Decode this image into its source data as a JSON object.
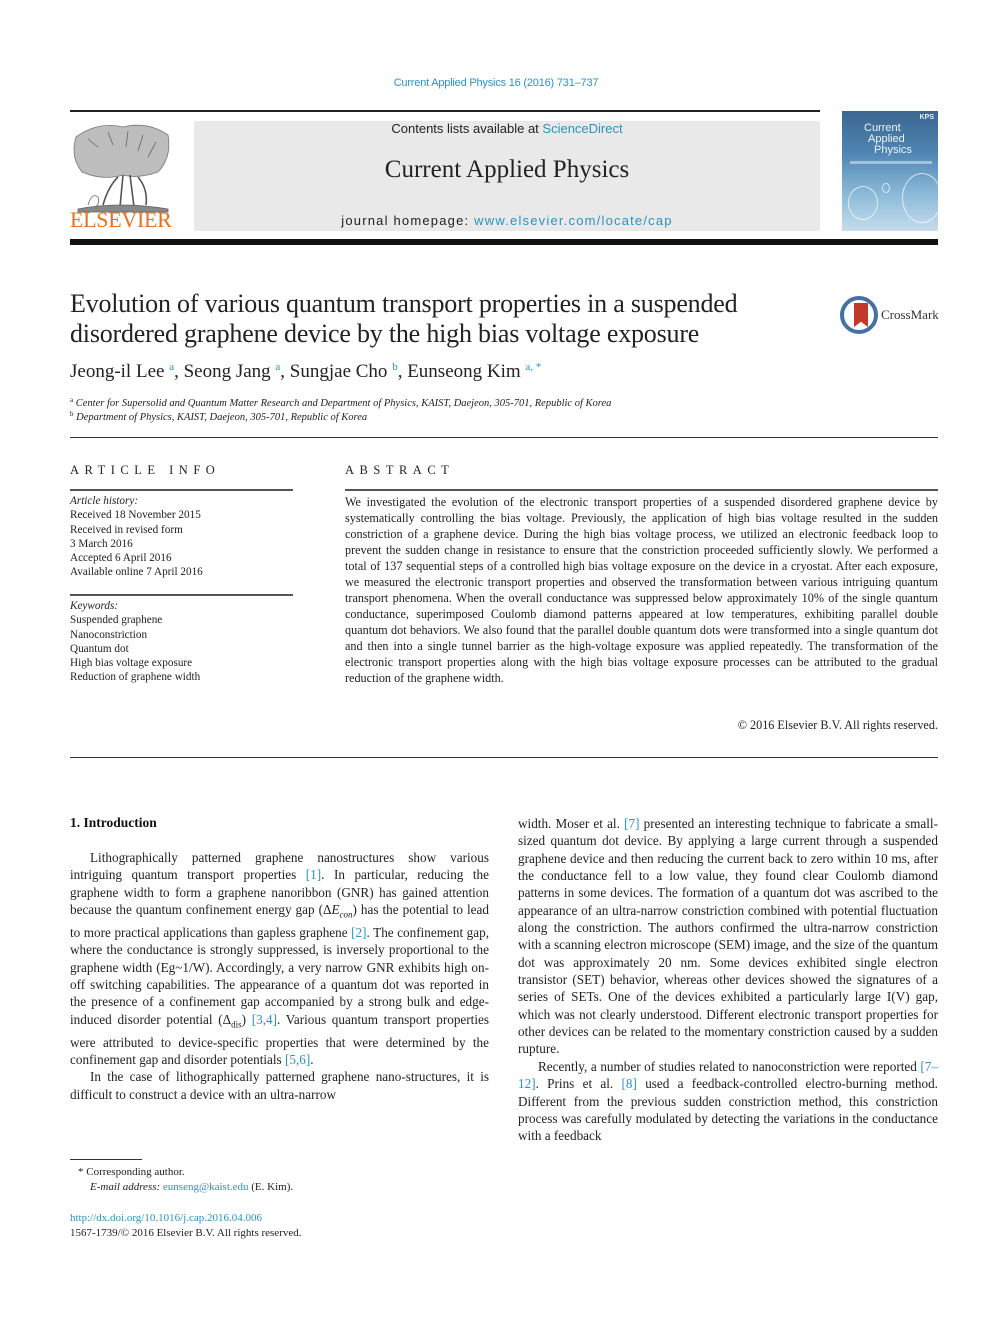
{
  "running_head": "Current Applied Physics 16 (2016) 731–737",
  "masthead": {
    "contents_prefix": "Contents lists available at ",
    "contents_link": "ScienceDirect",
    "journal_title": "Current Applied Physics",
    "homepage_prefix": "journal homepage: ",
    "homepage_link": "www.elsevier.com/locate/cap",
    "publisher_logo_text": "ELSEVIER",
    "cover": {
      "title_line1": "Current",
      "title_line2": "Applied",
      "title_line3": "Physics",
      "badge": "KPS"
    },
    "colors": {
      "link": "#2a93c4",
      "elsevier_orange": "#e9711c",
      "masthead_bg": "#e9e9e9"
    }
  },
  "article": {
    "title": "Evolution of various quantum transport properties in a suspended disordered graphene device by the high bias voltage exposure",
    "crossmark_label": "CrossMark",
    "authors": [
      {
        "name": "Jeong-il Lee",
        "affil": "a"
      },
      {
        "name": "Seong Jang",
        "affil": "a"
      },
      {
        "name": "Sungjae Cho",
        "affil": "b"
      },
      {
        "name": "Eunseong Kim",
        "affil": "a, *"
      }
    ],
    "affiliations": [
      {
        "mark": "a",
        "text": "Center for Supersolid and Quantum Matter Research and Department of Physics, KAIST, Daejeon, 305-701, Republic of Korea"
      },
      {
        "mark": "b",
        "text": "Department of Physics, KAIST, Daejeon, 305-701, Republic of Korea"
      }
    ]
  },
  "article_info": {
    "heading": "ARTICLE INFO",
    "history_label": "Article history:",
    "history": [
      "Received 18 November 2015",
      "Received in revised form",
      "3 March 2016",
      "Accepted 6 April 2016",
      "Available online 7 April 2016"
    ],
    "keywords_label": "Keywords:",
    "keywords": [
      "Suspended graphene",
      "Nanoconstriction",
      "Quantum dot",
      "High bias voltage exposure",
      "Reduction of graphene width"
    ]
  },
  "abstract": {
    "heading": "ABSTRACT",
    "text": "We investigated the evolution of the electronic transport properties of a suspended disordered graphene device by systematically controlling the bias voltage. Previously, the application of high bias voltage resulted in the sudden constriction of a graphene device. During the high bias voltage process, we utilized an electronic feedback loop to prevent the sudden change in resistance to ensure that the constriction proceeded sufficiently slowly. We performed a total of 137 sequential steps of a controlled high bias voltage exposure on the device in a cryostat. After each exposure, we measured the electronic transport properties and observed the transformation between various intriguing quantum transport phenomena. When the overall conductance was suppressed below approximately 10% of the single quantum conductance, superimposed Coulomb diamond patterns appeared at low temperatures, exhibiting parallel double quantum dot behaviors. We also found that the parallel double quantum dots were transformed into a single quantum dot and then into a single tunnel barrier as the high-voltage exposure was applied repeatedly. The transformation of the electronic transport properties along with the high bias voltage exposure processes can be attributed to the gradual reduction of the graphene width.",
    "copyright": "© 2016 Elsevier B.V. All rights reserved."
  },
  "body": {
    "section_heading": "1.  Introduction",
    "left": {
      "p1_a": "Lithographically patterned graphene nanostructures show various intriguing quantum transport properties ",
      "ref1": "[1]",
      "p1_b": ". In particular, reducing the graphene width to form a graphene nanoribbon (GNR) has gained attention because the quantum confinement energy gap (Δ",
      "econ_E": "E",
      "econ_sub": "con",
      "p1_c": ") has the potential to lead to more practical applications than gapless graphene ",
      "ref2": "[2]",
      "p1_d": ". The confinement gap, where the conductance is strongly suppressed, is inversely proportional to the graphene width (Eg~1/W). Accordingly, a very narrow GNR exhibits high on-off switching capabilities. The appearance of a quantum dot was reported in the presence of a confinement gap accompanied by a strong bulk and edge-induced disorder potential (Δ",
      "dis_sub": "dis",
      "p1_e": ") ",
      "ref34": "[3,4]",
      "p1_f": ". Various quantum transport properties were attributed to device-specific properties that were determined by the confinement gap and disorder potentials ",
      "ref56": "[5,6]",
      "p1_g": ".",
      "p2": "In the case of lithographically patterned graphene nano-structures, it is difficult to construct a device with an ultra-narrow"
    },
    "right": {
      "p1_a": "width. Moser et al. ",
      "ref7": "[7]",
      "p1_b": " presented an interesting technique to fabricate a small-sized quantum dot device. By applying a large current through a suspended graphene device and then reducing the current back to zero within 10 ms, after the conductance fell to a low value, they found clear Coulomb diamond patterns in some devices. The formation of a quantum dot was ascribed to the appearance of an ultra-narrow constriction combined with potential fluctuation along the constriction. The authors confirmed the ultra-narrow constriction with a scanning electron microscope (SEM) image, and the size of the quantum dot was approximately 20 nm. Some devices exhibited single electron transistor (SET) behavior, whereas other devices showed the signatures of a series of SETs. One of the devices exhibited a particularly large I(V) gap, which was not clearly understood. Different electronic transport properties for other devices can be related to the momentary constriction caused by a sudden rupture.",
      "p2_a": "Recently, a number of studies related to nanoconstriction were reported ",
      "ref712": "[7–12]",
      "p2_b": ". Prins et al. ",
      "ref8": "[8]",
      "p2_c": " used a feedback-controlled electro-burning method. Different from the previous sudden constriction method, this constriction process was carefully modulated by detecting the variations in the conductance with a feedback"
    }
  },
  "footnotes": {
    "corresponding": "* Corresponding author.",
    "email_label": "E-mail address: ",
    "email": "eunseng@kaist.edu",
    "email_suffix": " (E. Kim).",
    "doi": "http://dx.doi.org/10.1016/j.cap.2016.04.006",
    "issn": "1567-1739/© 2016 Elsevier B.V. All rights reserved."
  }
}
